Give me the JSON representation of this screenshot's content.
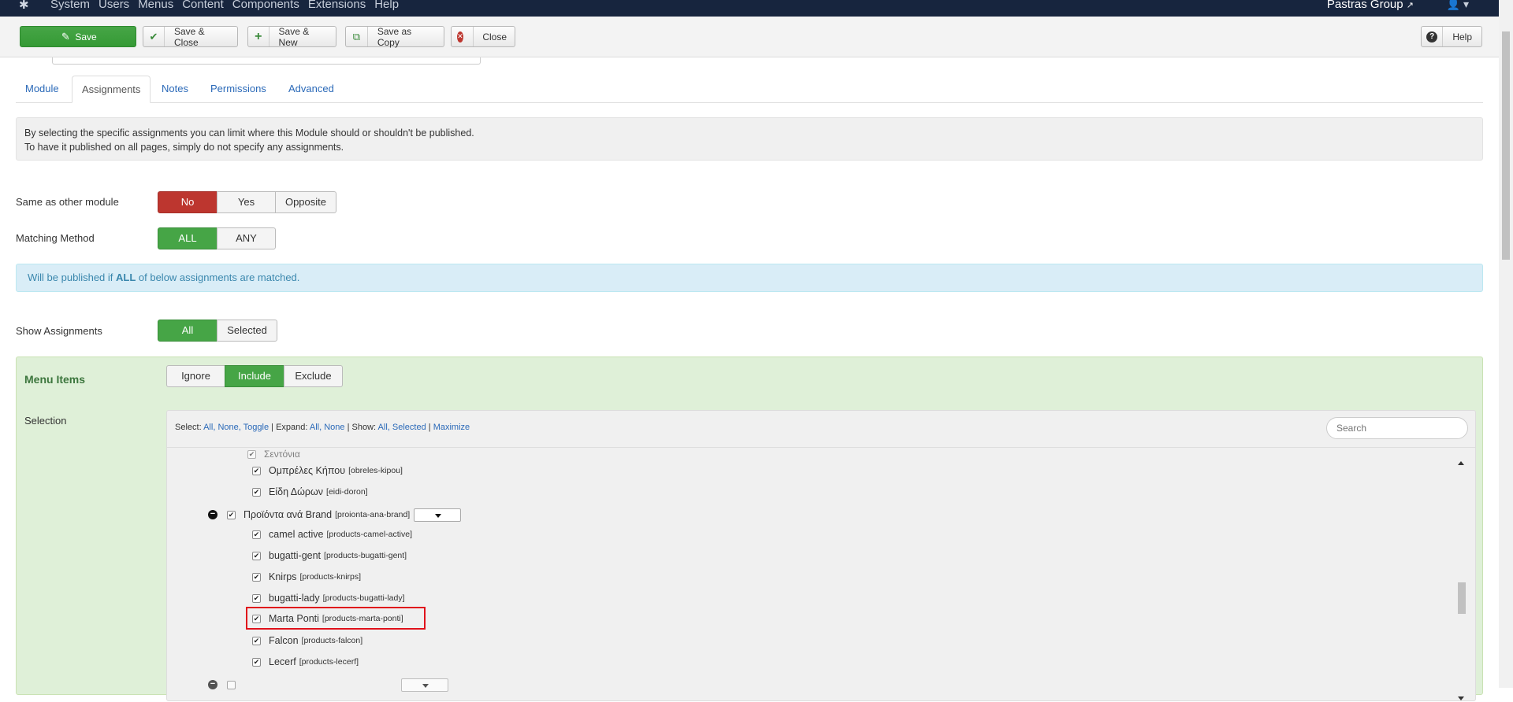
{
  "navbar": {
    "menu": [
      "System",
      "Users",
      "Menus",
      "Content",
      "Components",
      "Extensions",
      "Help"
    ],
    "site_name": "Pastras Group",
    "site_icon": "external-link-icon",
    "user_icon": "user-icon"
  },
  "toolbar": {
    "save": "Save",
    "save_close": "Save & Close",
    "save_new": "Save & New",
    "save_copy": "Save as Copy",
    "close": "Close",
    "help": "Help"
  },
  "tabs": [
    "Module",
    "Assignments",
    "Notes",
    "Permissions",
    "Advanced"
  ],
  "active_tab": "Assignments",
  "info": {
    "line1": "By selecting the specific assignments you can limit where this Module should or shouldn't be published.",
    "line2": "To have it published on all pages, simply do not specify any assignments."
  },
  "same_as_other": {
    "label": "Same as other module",
    "options": [
      "No",
      "Yes",
      "Opposite"
    ],
    "selected": "No"
  },
  "matching_method": {
    "label": "Matching Method",
    "options": [
      "ALL",
      "ANY"
    ],
    "selected": "ALL"
  },
  "alert": {
    "prefix": "Will be published if ",
    "strong": "ALL",
    "suffix": " of below assignments are matched."
  },
  "show_assignments": {
    "label": "Show Assignments",
    "options": [
      "All",
      "Selected"
    ],
    "selected": "All"
  },
  "menu_items": {
    "title": "Menu Items",
    "options": [
      "Ignore",
      "Include",
      "Exclude"
    ],
    "selected": "Include",
    "selection_label": "Selection",
    "toolbar": {
      "select_label": "Select:",
      "select_all": "All,",
      "select_none": "None,",
      "select_toggle": "Toggle",
      "expand_label": "Expand:",
      "expand_all": "All,",
      "expand_none": "None",
      "show_label": "Show:",
      "show_all": "All,",
      "show_selected": "Selected",
      "maximize": "Maximize",
      "search_placeholder": "Search"
    },
    "items": [
      {
        "title": "Ομπρέλες Κήπου",
        "alias": "[obreles-kipou]",
        "level": 2,
        "checked": true
      },
      {
        "title": "Είδη Δώρων",
        "alias": "[eidi-doron]",
        "level": 2,
        "checked": true
      },
      {
        "title": "Προϊόντα ανά Brand",
        "alias": "[proionta-ana-brand]",
        "level": 1,
        "checked": true
      },
      {
        "title": "camel active",
        "alias": "[products-camel-active]",
        "level": 2,
        "checked": true
      },
      {
        "title": "bugatti-gent",
        "alias": "[products-bugatti-gent]",
        "level": 2,
        "checked": true
      },
      {
        "title": "Knirps",
        "alias": "[products-knirps]",
        "level": 2,
        "checked": true
      },
      {
        "title": "bugatti-lady",
        "alias": "[products-bugatti-lady]",
        "level": 2,
        "checked": true
      },
      {
        "title": "Marta Ponti",
        "alias": "[products-marta-ponti]",
        "level": 2,
        "checked": true,
        "highlighted": true
      },
      {
        "title": "Falcon",
        "alias": "[products-falcon]",
        "level": 2,
        "checked": true
      },
      {
        "title": "Lecerf",
        "alias": "[products-lecerf]",
        "level": 2,
        "checked": true
      }
    ]
  }
}
